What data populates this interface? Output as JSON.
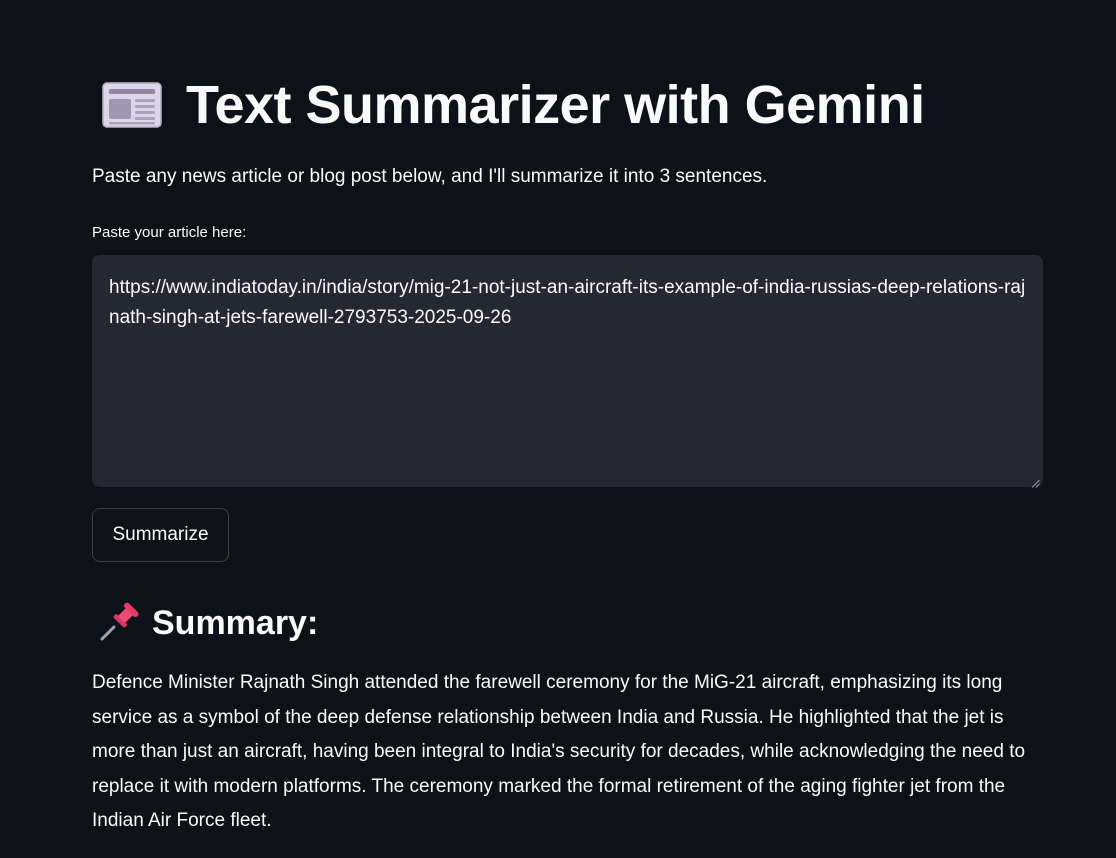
{
  "app": {
    "title": "Text Summarizer with Gemini",
    "title_icon": "newspaper-icon",
    "subtitle": "Paste any news article or blog post below, and I'll summarize it into 3 sentences."
  },
  "input": {
    "label": "Paste your article here:",
    "value": "https://www.indiatoday.in/india/story/mig-21-not-just-an-aircraft-its-example-of-india-russias-deep-relations-rajnath-singh-at-jets-farewell-2793753-2025-09-26"
  },
  "button": {
    "label": "Summarize"
  },
  "summary": {
    "icon": "pushpin-icon",
    "heading": "Summary:",
    "text": "Defence Minister Rajnath Singh attended the farewell ceremony for the MiG-21 aircraft, emphasizing its long service as a symbol of the deep defense relationship between India and Russia. He highlighted that the jet is more than just an aircraft, having been integral to India's security for decades, while acknowledging the need to replace it with modern platforms. The ceremony marked the formal retirement of the aging fighter jet from the Indian Air Force fleet."
  },
  "colors": {
    "background": "#0e1117",
    "text": "#fafafa",
    "input_background": "#262730",
    "button_border": "#3d3f49"
  }
}
